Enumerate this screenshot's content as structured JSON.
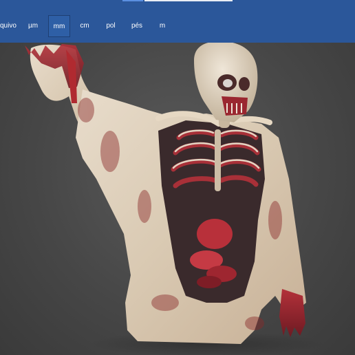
{
  "toolbar": {
    "background": "#2b579a",
    "selected_unit": "mm",
    "units": [
      {
        "label": "quivo",
        "name": "unit-tab-arquivo"
      },
      {
        "label": "µm",
        "name": "unit-tab-um"
      },
      {
        "label": "mm",
        "name": "unit-tab-mm"
      },
      {
        "label": "cm",
        "name": "unit-tab-cm"
      },
      {
        "label": "pol",
        "name": "unit-tab-pol"
      },
      {
        "label": "pés",
        "name": "unit-tab-pes"
      },
      {
        "label": "m",
        "name": "unit-tab-m"
      }
    ]
  },
  "viewport": {
    "model": "zombie-torso-3d-model",
    "background": "#4a4a4a"
  }
}
